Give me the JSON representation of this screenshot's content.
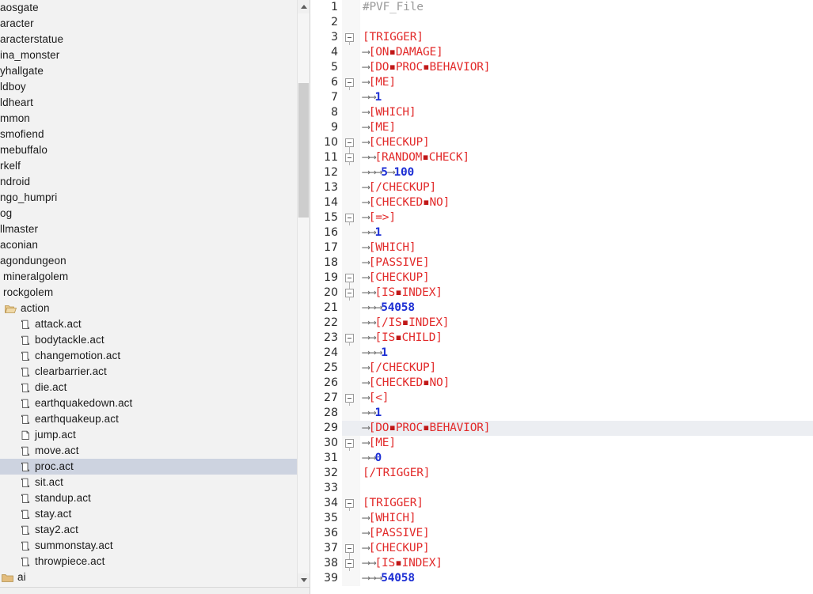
{
  "tree": {
    "scrollbar": {
      "up_icon": "chevron-up-icon",
      "down_icon": "chevron-down-icon"
    },
    "selected_item": "proc.act",
    "items": [
      {
        "label": "aosgate",
        "indent": 0,
        "icon": "none"
      },
      {
        "label": "aracter",
        "indent": 0,
        "icon": "none"
      },
      {
        "label": "aracterstatue",
        "indent": 0,
        "icon": "none"
      },
      {
        "label": "ina_monster",
        "indent": 0,
        "icon": "none"
      },
      {
        "label": "yhallgate",
        "indent": 0,
        "icon": "none"
      },
      {
        "label": "ldboy",
        "indent": 0,
        "icon": "none"
      },
      {
        "label": "ldheart",
        "indent": 0,
        "icon": "none"
      },
      {
        "label": "mmon",
        "indent": 0,
        "icon": "none"
      },
      {
        "label": "smofiend",
        "indent": 0,
        "icon": "none"
      },
      {
        "label": "mebuffalo",
        "indent": 0,
        "icon": "none"
      },
      {
        "label": "rkelf",
        "indent": 0,
        "icon": "none"
      },
      {
        "label": "ndroid",
        "indent": 0,
        "icon": "none"
      },
      {
        "label": "ngo_humpri",
        "indent": 0,
        "icon": "none"
      },
      {
        "label": "og",
        "indent": 0,
        "icon": "none"
      },
      {
        "label": "llmaster",
        "indent": 0,
        "icon": "none"
      },
      {
        "label": "aconian",
        "indent": 0,
        "icon": "none"
      },
      {
        "label": "agondungeon",
        "indent": 0,
        "icon": "none"
      },
      {
        "label": "mineralgolem",
        "indent": 1,
        "icon": "none"
      },
      {
        "label": "rockgolem",
        "indent": 1,
        "icon": "none"
      },
      {
        "label": "action",
        "indent": 1,
        "icon": "folder-open-icon"
      },
      {
        "label": "attack.act",
        "indent": 2,
        "icon": "file-act-icon"
      },
      {
        "label": "bodytackle.act",
        "indent": 2,
        "icon": "file-act-icon"
      },
      {
        "label": "changemotion.act",
        "indent": 2,
        "icon": "file-act-icon"
      },
      {
        "label": "clearbarrier.act",
        "indent": 2,
        "icon": "file-act-icon"
      },
      {
        "label": "die.act",
        "indent": 2,
        "icon": "file-act-icon"
      },
      {
        "label": "earthquakedown.act",
        "indent": 2,
        "icon": "file-act-icon"
      },
      {
        "label": "earthquakeup.act",
        "indent": 2,
        "icon": "file-act-icon"
      },
      {
        "label": "jump.act",
        "indent": 2,
        "icon": "file-plain-icon"
      },
      {
        "label": "move.act",
        "indent": 2,
        "icon": "file-act-icon"
      },
      {
        "label": "proc.act",
        "indent": 2,
        "icon": "file-act-icon",
        "selected": true
      },
      {
        "label": "sit.act",
        "indent": 2,
        "icon": "file-act-icon"
      },
      {
        "label": "standup.act",
        "indent": 2,
        "icon": "file-act-icon"
      },
      {
        "label": "stay.act",
        "indent": 2,
        "icon": "file-act-icon"
      },
      {
        "label": "stay2.act",
        "indent": 2,
        "icon": "file-act-icon"
      },
      {
        "label": "summonstay.act",
        "indent": 2,
        "icon": "file-act-icon"
      },
      {
        "label": "throwpiece.act",
        "indent": 2,
        "icon": "file-act-icon"
      },
      {
        "label": "ai",
        "indent": 0,
        "icon": "folder-closed-icon"
      }
    ]
  },
  "editor": {
    "current_line": 29,
    "colors": {
      "tag": "#e22b2b",
      "number": "#1d2fd4",
      "comment": "#9a9a9a",
      "tab_arrow": "#6e6e6e",
      "current_line_bg": "#eceef2"
    },
    "lines": [
      {
        "n": 1,
        "fold": "none",
        "tokens": [
          {
            "t": "comment",
            "v": "#PVF_File"
          }
        ]
      },
      {
        "n": 2,
        "fold": "none",
        "tokens": []
      },
      {
        "n": 3,
        "fold": "open",
        "tokens": [
          {
            "t": "tag",
            "v": "[TRIGGER]"
          }
        ]
      },
      {
        "n": 4,
        "fold": "none",
        "tokens": [
          {
            "t": "tab",
            "v": 1
          },
          {
            "t": "tag",
            "v": "[ON▪DAMAGE]"
          }
        ]
      },
      {
        "n": 5,
        "fold": "none",
        "tokens": [
          {
            "t": "tab",
            "v": 1
          },
          {
            "t": "tag",
            "v": "[DO▪PROC▪BEHAVIOR]"
          }
        ]
      },
      {
        "n": 6,
        "fold": "open",
        "tokens": [
          {
            "t": "tab",
            "v": 1
          },
          {
            "t": "tag",
            "v": "[ME]"
          }
        ]
      },
      {
        "n": 7,
        "fold": "none",
        "tokens": [
          {
            "t": "tab",
            "v": 2
          },
          {
            "t": "num",
            "v": "1"
          }
        ]
      },
      {
        "n": 8,
        "fold": "none",
        "tokens": [
          {
            "t": "tab",
            "v": 1
          },
          {
            "t": "tag",
            "v": "[WHICH]"
          }
        ]
      },
      {
        "n": 9,
        "fold": "none",
        "tokens": [
          {
            "t": "tab",
            "v": 1
          },
          {
            "t": "tag",
            "v": "[ME]"
          }
        ]
      },
      {
        "n": 10,
        "fold": "open",
        "tokens": [
          {
            "t": "tab",
            "v": 1
          },
          {
            "t": "tag",
            "v": "[CHECKUP]"
          }
        ]
      },
      {
        "n": 11,
        "fold": "open",
        "tokens": [
          {
            "t": "tab",
            "v": 2
          },
          {
            "t": "tag",
            "v": "[RANDOM▪CHECK]"
          }
        ]
      },
      {
        "n": 12,
        "fold": "none",
        "tokens": [
          {
            "t": "tab",
            "v": 3
          },
          {
            "t": "num",
            "v": "5"
          },
          {
            "t": "tab",
            "v": 1
          },
          {
            "t": "num",
            "v": "100"
          }
        ]
      },
      {
        "n": 13,
        "fold": "none",
        "tokens": [
          {
            "t": "tab",
            "v": 1
          },
          {
            "t": "tag",
            "v": "[/CHECKUP]"
          }
        ]
      },
      {
        "n": 14,
        "fold": "none",
        "tokens": [
          {
            "t": "tab",
            "v": 1
          },
          {
            "t": "tag",
            "v": "[CHECKED▪NO]"
          }
        ]
      },
      {
        "n": 15,
        "fold": "open",
        "tokens": [
          {
            "t": "tab",
            "v": 1
          },
          {
            "t": "tag",
            "v": "[=>]"
          }
        ]
      },
      {
        "n": 16,
        "fold": "none",
        "tokens": [
          {
            "t": "tab",
            "v": 2
          },
          {
            "t": "num",
            "v": "1"
          }
        ]
      },
      {
        "n": 17,
        "fold": "none",
        "tokens": [
          {
            "t": "tab",
            "v": 1
          },
          {
            "t": "tag",
            "v": "[WHICH]"
          }
        ]
      },
      {
        "n": 18,
        "fold": "none",
        "tokens": [
          {
            "t": "tab",
            "v": 1
          },
          {
            "t": "tag",
            "v": "[PASSIVE]"
          }
        ]
      },
      {
        "n": 19,
        "fold": "open",
        "tokens": [
          {
            "t": "tab",
            "v": 1
          },
          {
            "t": "tag",
            "v": "[CHECKUP]"
          }
        ]
      },
      {
        "n": 20,
        "fold": "open",
        "tokens": [
          {
            "t": "tab",
            "v": 2
          },
          {
            "t": "tag",
            "v": "[IS▪INDEX]"
          }
        ]
      },
      {
        "n": 21,
        "fold": "none",
        "tokens": [
          {
            "t": "tab",
            "v": 3
          },
          {
            "t": "num",
            "v": "54058"
          }
        ]
      },
      {
        "n": 22,
        "fold": "none",
        "tokens": [
          {
            "t": "tab",
            "v": 2
          },
          {
            "t": "tag",
            "v": "[/IS▪INDEX]"
          }
        ]
      },
      {
        "n": 23,
        "fold": "open",
        "tokens": [
          {
            "t": "tab",
            "v": 2
          },
          {
            "t": "tag",
            "v": "[IS▪CHILD]"
          }
        ]
      },
      {
        "n": 24,
        "fold": "none",
        "tokens": [
          {
            "t": "tab",
            "v": 3
          },
          {
            "t": "num",
            "v": "1"
          }
        ]
      },
      {
        "n": 25,
        "fold": "none",
        "tokens": [
          {
            "t": "tab",
            "v": 1
          },
          {
            "t": "tag",
            "v": "[/CHECKUP]"
          }
        ]
      },
      {
        "n": 26,
        "fold": "none",
        "tokens": [
          {
            "t": "tab",
            "v": 1
          },
          {
            "t": "tag",
            "v": "[CHECKED▪NO]"
          }
        ]
      },
      {
        "n": 27,
        "fold": "open",
        "tokens": [
          {
            "t": "tab",
            "v": 1
          },
          {
            "t": "tag",
            "v": "[<]"
          }
        ]
      },
      {
        "n": 28,
        "fold": "none",
        "tokens": [
          {
            "t": "tab",
            "v": 2
          },
          {
            "t": "num",
            "v": "1"
          }
        ]
      },
      {
        "n": 29,
        "fold": "none",
        "tokens": [
          {
            "t": "tab",
            "v": 1
          },
          {
            "t": "tag",
            "v": "[DO▪PROC▪BEHAVIOR]"
          }
        ]
      },
      {
        "n": 30,
        "fold": "open",
        "tokens": [
          {
            "t": "tab",
            "v": 1
          },
          {
            "t": "tag",
            "v": "[ME]"
          }
        ]
      },
      {
        "n": 31,
        "fold": "none",
        "tokens": [
          {
            "t": "tab",
            "v": 2
          },
          {
            "t": "num",
            "v": "0"
          }
        ]
      },
      {
        "n": 32,
        "fold": "none",
        "tokens": [
          {
            "t": "tag",
            "v": "[/TRIGGER]"
          }
        ]
      },
      {
        "n": 33,
        "fold": "none",
        "tokens": []
      },
      {
        "n": 34,
        "fold": "open",
        "tokens": [
          {
            "t": "tag",
            "v": "[TRIGGER]"
          }
        ]
      },
      {
        "n": 35,
        "fold": "none",
        "tokens": [
          {
            "t": "tab",
            "v": 1
          },
          {
            "t": "tag",
            "v": "[WHICH]"
          }
        ]
      },
      {
        "n": 36,
        "fold": "none",
        "tokens": [
          {
            "t": "tab",
            "v": 1
          },
          {
            "t": "tag",
            "v": "[PASSIVE]"
          }
        ]
      },
      {
        "n": 37,
        "fold": "open",
        "tokens": [
          {
            "t": "tab",
            "v": 1
          },
          {
            "t": "tag",
            "v": "[CHECKUP]"
          }
        ]
      },
      {
        "n": 38,
        "fold": "open",
        "tokens": [
          {
            "t": "tab",
            "v": 2
          },
          {
            "t": "tag",
            "v": "[IS▪INDEX]"
          }
        ]
      },
      {
        "n": 39,
        "fold": "none",
        "tokens": [
          {
            "t": "tab",
            "v": 3
          },
          {
            "t": "num",
            "v": "54058"
          }
        ]
      }
    ]
  }
}
